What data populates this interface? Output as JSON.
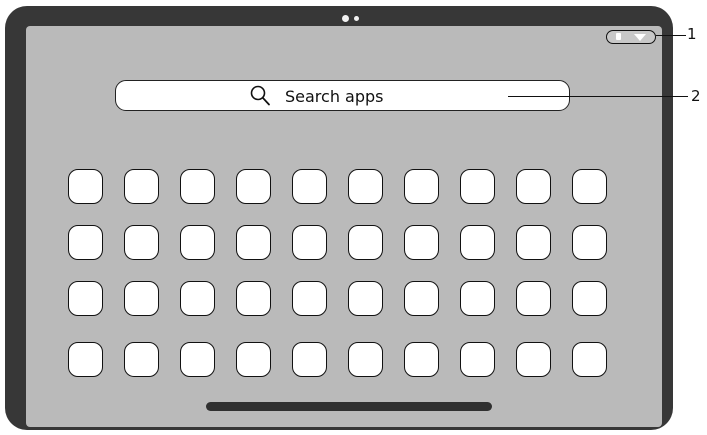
{
  "search": {
    "placeholder_text": "Search apps",
    "icon": "magnifier-icon"
  },
  "status_bar": {
    "icons": [
      "battery-icon",
      "wifi-icon"
    ]
  },
  "app_grid": {
    "rows": 4,
    "columns": 10
  },
  "callouts": [
    {
      "label": "1",
      "target": "status-bar"
    },
    {
      "label": "2",
      "target": "search-bar"
    }
  ],
  "colors": {
    "tablet_frame": "#373737",
    "screen_background": "#bababa",
    "app_icon_fill": "#ffffff",
    "home_indicator": "#303030"
  }
}
